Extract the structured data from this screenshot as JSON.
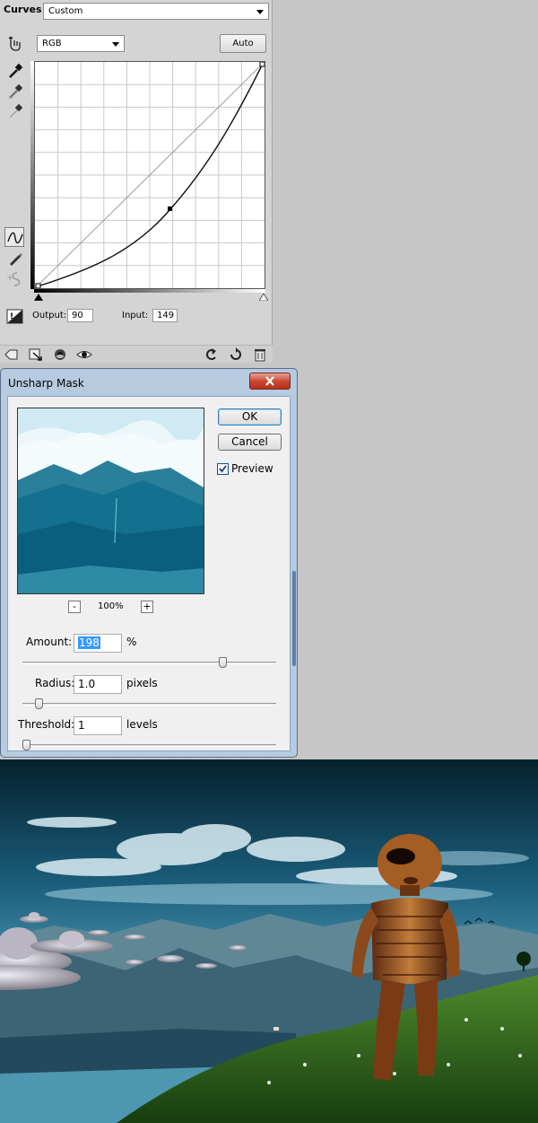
{
  "curves": {
    "title": "Curves",
    "preset": "Custom",
    "channel": "RGB",
    "auto_label": "Auto",
    "output_label": "Output:",
    "output_value": "90",
    "input_label": "Input:",
    "input_value": "149"
  },
  "unsharp_mask": {
    "title": "Unsharp Mask",
    "ok_label": "OK",
    "cancel_label": "Cancel",
    "preview_label": "Preview",
    "preview_checked": true,
    "zoom_out_label": "-",
    "zoom_level": "100%",
    "zoom_in_label": "+",
    "amount_label": "Amount:",
    "amount_value": "198",
    "amount_unit": "%",
    "radius_label": "Radius:",
    "radius_value": "1.0",
    "radius_unit": "pixels",
    "threshold_label": "Threshold:",
    "threshold_value": "1",
    "threshold_unit": "levels",
    "amount_slider_fraction": 0.8,
    "radius_slider_fraction": 0.05,
    "threshold_slider_fraction": 0.0
  },
  "icons": {
    "curves_tools": [
      "hand-adjust-icon",
      "black-point-eyedropper-icon",
      "gray-point-eyedropper-icon",
      "white-point-eyedropper-icon",
      "curve-point-icon",
      "pencil-icon",
      "smooth-icon",
      "clipping-warning-icon"
    ],
    "footer": [
      "back-arrow-icon",
      "clip-to-layer-icon",
      "visibility-eye-icon",
      "preview-eye-icon",
      "reset-icon",
      "refresh-icon",
      "trash-icon"
    ]
  },
  "colors": {
    "dialog_accent": "#3399ff",
    "close_button": "#c8432d",
    "scene_sky": "#1b5f7d",
    "scene_grass": "#2c5a1e"
  }
}
